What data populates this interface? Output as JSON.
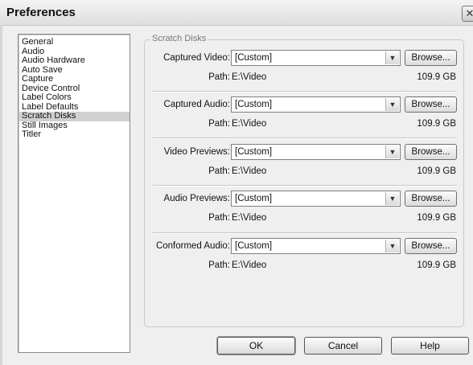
{
  "window": {
    "title": "Preferences",
    "close_glyph": "✕"
  },
  "categories": [
    "General",
    "Audio",
    "Audio Hardware",
    "Auto Save",
    "Capture",
    "Device Control",
    "Label Colors",
    "Label Defaults",
    "Scratch Disks",
    "Still Images",
    "Titler"
  ],
  "selected_category": "Scratch Disks",
  "group_title": "Scratch Disks",
  "rows": [
    {
      "label": "Captured Video:",
      "value": "[Custom]",
      "browse": "Browse...",
      "path_label": "Path:",
      "path": "E:\\Video",
      "size": "109.9 GB"
    },
    {
      "label": "Captured Audio:",
      "value": "[Custom]",
      "browse": "Browse...",
      "path_label": "Path:",
      "path": "E:\\Video",
      "size": "109.9 GB"
    },
    {
      "label": "Video Previews:",
      "value": "[Custom]",
      "browse": "Browse...",
      "path_label": "Path:",
      "path": "E:\\Video",
      "size": "109.9 GB"
    },
    {
      "label": "Audio Previews:",
      "value": "[Custom]",
      "browse": "Browse...",
      "path_label": "Path:",
      "path": "E:\\Video",
      "size": "109.9 GB"
    },
    {
      "label": "Conformed Audio:",
      "value": "[Custom]",
      "browse": "Browse...",
      "path_label": "Path:",
      "path": "E:\\Video",
      "size": "109.9 GB"
    }
  ],
  "dropdown_arrow": "▼",
  "buttons": {
    "ok": "OK",
    "cancel": "Cancel",
    "help": "Help"
  }
}
